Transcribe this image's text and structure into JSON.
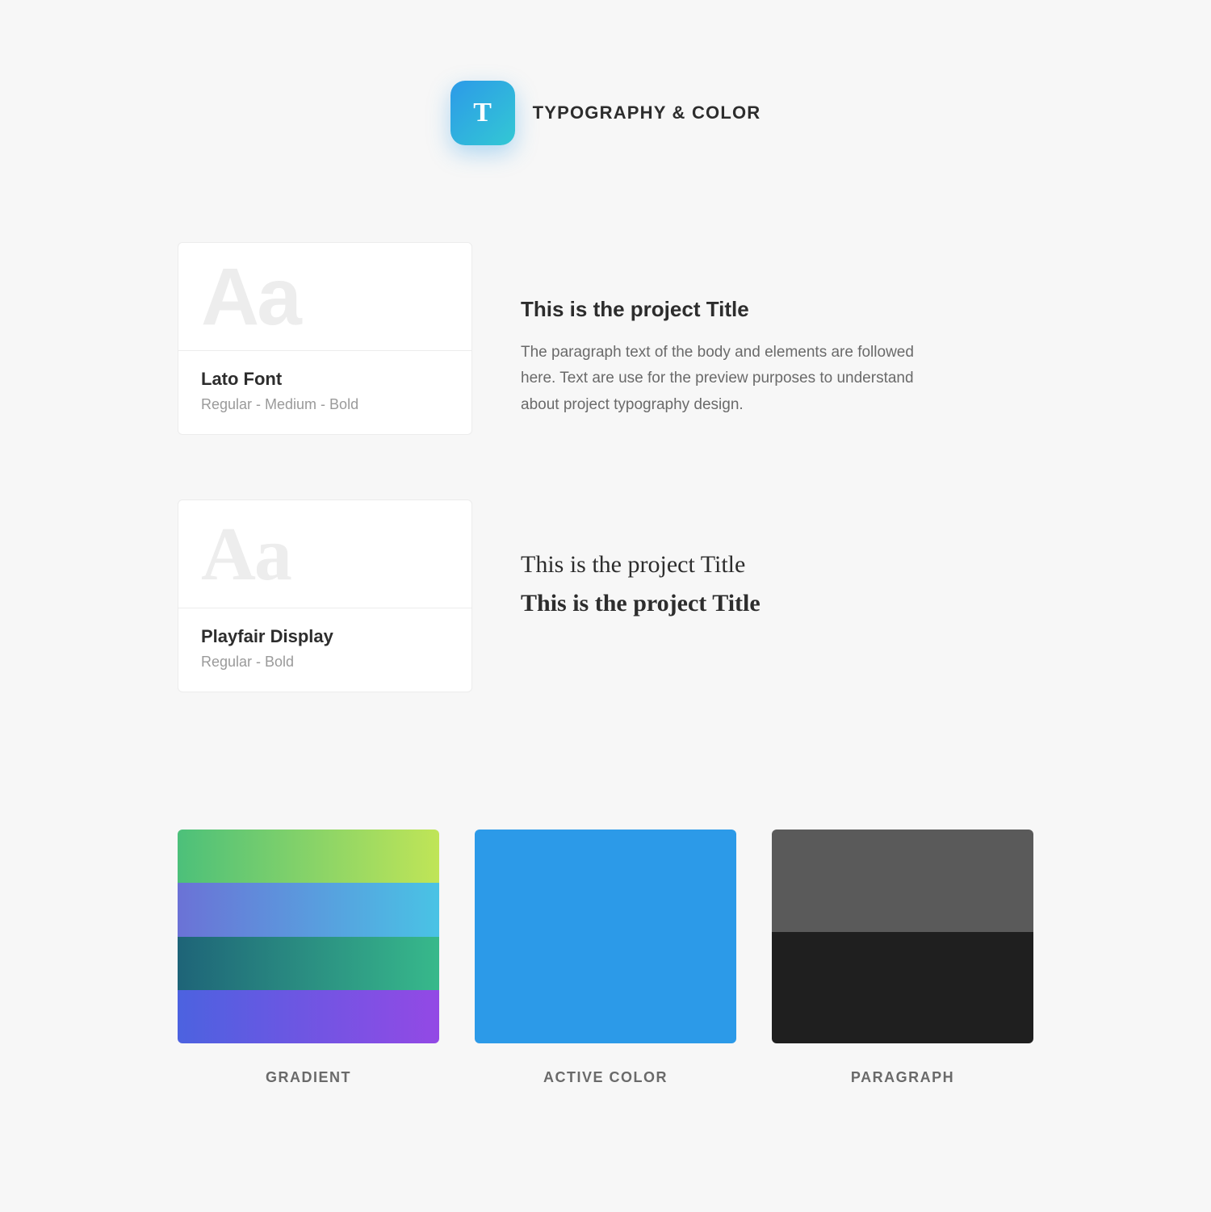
{
  "header": {
    "badge_letter": "T",
    "title": "TYPOGRAPHY & COLOR"
  },
  "fonts": [
    {
      "specimen": "Aa",
      "name": "Lato Font",
      "weights": "Regular - Medium - Bold",
      "serif": false,
      "preview": {
        "title": "This is the project Title",
        "paragraph": "The paragraph text of the body and elements are followed here. Text are use for the preview purposes to understand about project typography design."
      }
    },
    {
      "specimen": "Aa",
      "name": "Playfair Display",
      "weights": "Regular - Bold",
      "serif": true,
      "preview": {
        "title_regular": "This is the project Title",
        "title_bold": "This is the project Title"
      }
    }
  ],
  "swatches": {
    "gradient": {
      "label": "GRADIENT",
      "rows": [
        {
          "from": "#4CC07A",
          "to": "#C0E557"
        },
        {
          "from": "#6B72D6",
          "to": "#49C3E5"
        },
        {
          "from": "#1E6478",
          "to": "#37B98B"
        },
        {
          "from": "#4C62E0",
          "to": "#9349E5"
        }
      ]
    },
    "active": {
      "label": "ACTIVE  COLOR",
      "color": "#2C9AE8"
    },
    "paragraph": {
      "label": "PARAGRAPH",
      "top": "#5A5A5A",
      "bottom": "#1F1F1F"
    }
  }
}
